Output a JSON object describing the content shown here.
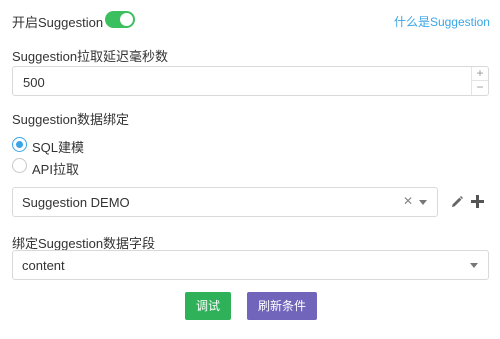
{
  "suggestion_toggle": {
    "label": "开启Suggestion",
    "enabled": true,
    "accent": "#3cbf5f"
  },
  "help_link": {
    "label": "什么是Suggestion"
  },
  "delay": {
    "label": "Suggestion拉取延迟毫秒数",
    "value": "500",
    "increment": "+",
    "decrement": "−"
  },
  "binding": {
    "label": "Suggestion数据绑定",
    "options": [
      {
        "label": "SQL建模",
        "selected": true
      },
      {
        "label": "API拉取",
        "selected": false
      }
    ],
    "selected_value": "Suggestion DEMO",
    "clear_icon": "✕"
  },
  "field": {
    "label": "绑定Suggestion数据字段",
    "selected_value": "content"
  },
  "actions": {
    "debug": {
      "label": "调试",
      "color": "#2fb15a"
    },
    "refresh": {
      "label": "刷新条件",
      "color": "#7064bb"
    }
  }
}
